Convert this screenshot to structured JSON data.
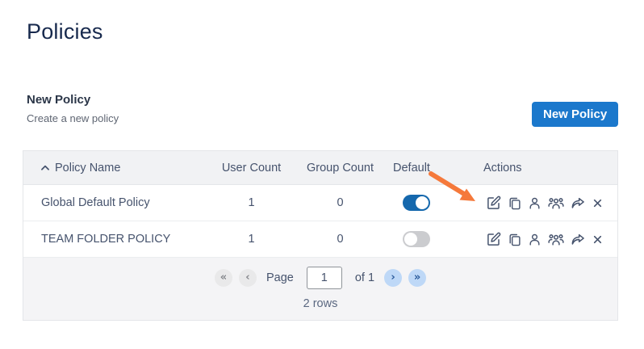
{
  "page": {
    "title": "Policies"
  },
  "section": {
    "heading": "New Policy",
    "subheading": "Create a new policy",
    "new_policy_button": "New Policy"
  },
  "table": {
    "columns": {
      "policy_name": "Policy Name",
      "user_count": "User Count",
      "group_count": "Group Count",
      "default": "Default",
      "actions": "Actions"
    },
    "sort": {
      "column": "Policy Name",
      "direction": "ascending",
      "icon": "chevron-up-icon"
    },
    "action_icons": [
      "edit-icon",
      "copy-icon",
      "user-icon",
      "users-icon",
      "share-icon",
      "close-icon"
    ],
    "rows": [
      {
        "policy_name": "Global Default Policy",
        "user_count": "1",
        "group_count": "0",
        "default_on": true,
        "toggle_class": "toggle on",
        "toggle_state": "on"
      },
      {
        "policy_name": "TEAM FOLDER POLICY",
        "user_count": "1",
        "group_count": "0",
        "default_on": false,
        "toggle_class": "toggle off",
        "toggle_state": "off"
      }
    ]
  },
  "pagination": {
    "first_label": "«",
    "prev_label": "‹",
    "page_label": "Page",
    "page_value": "1",
    "of_label": "of 1",
    "next_label": "›",
    "last_label": "»",
    "rows_summary": "2 rows"
  },
  "annotation": {
    "type": "orange-arrow",
    "points_to": "edit-icon of first row",
    "color": "#f5793b"
  },
  "colors": {
    "title_navy": "#17294d",
    "accent_blue": "#1b78cc",
    "toggle_on_blue": "#1568ad",
    "toggle_off_gray": "#cbcccf",
    "pager_enabled_bg": "#bed8f7",
    "pager_disabled_bg": "#e9e9ea",
    "header_bg": "#f1f2f4",
    "footer_bg": "#f4f4f6",
    "arrow_orange": "#f5793b"
  }
}
